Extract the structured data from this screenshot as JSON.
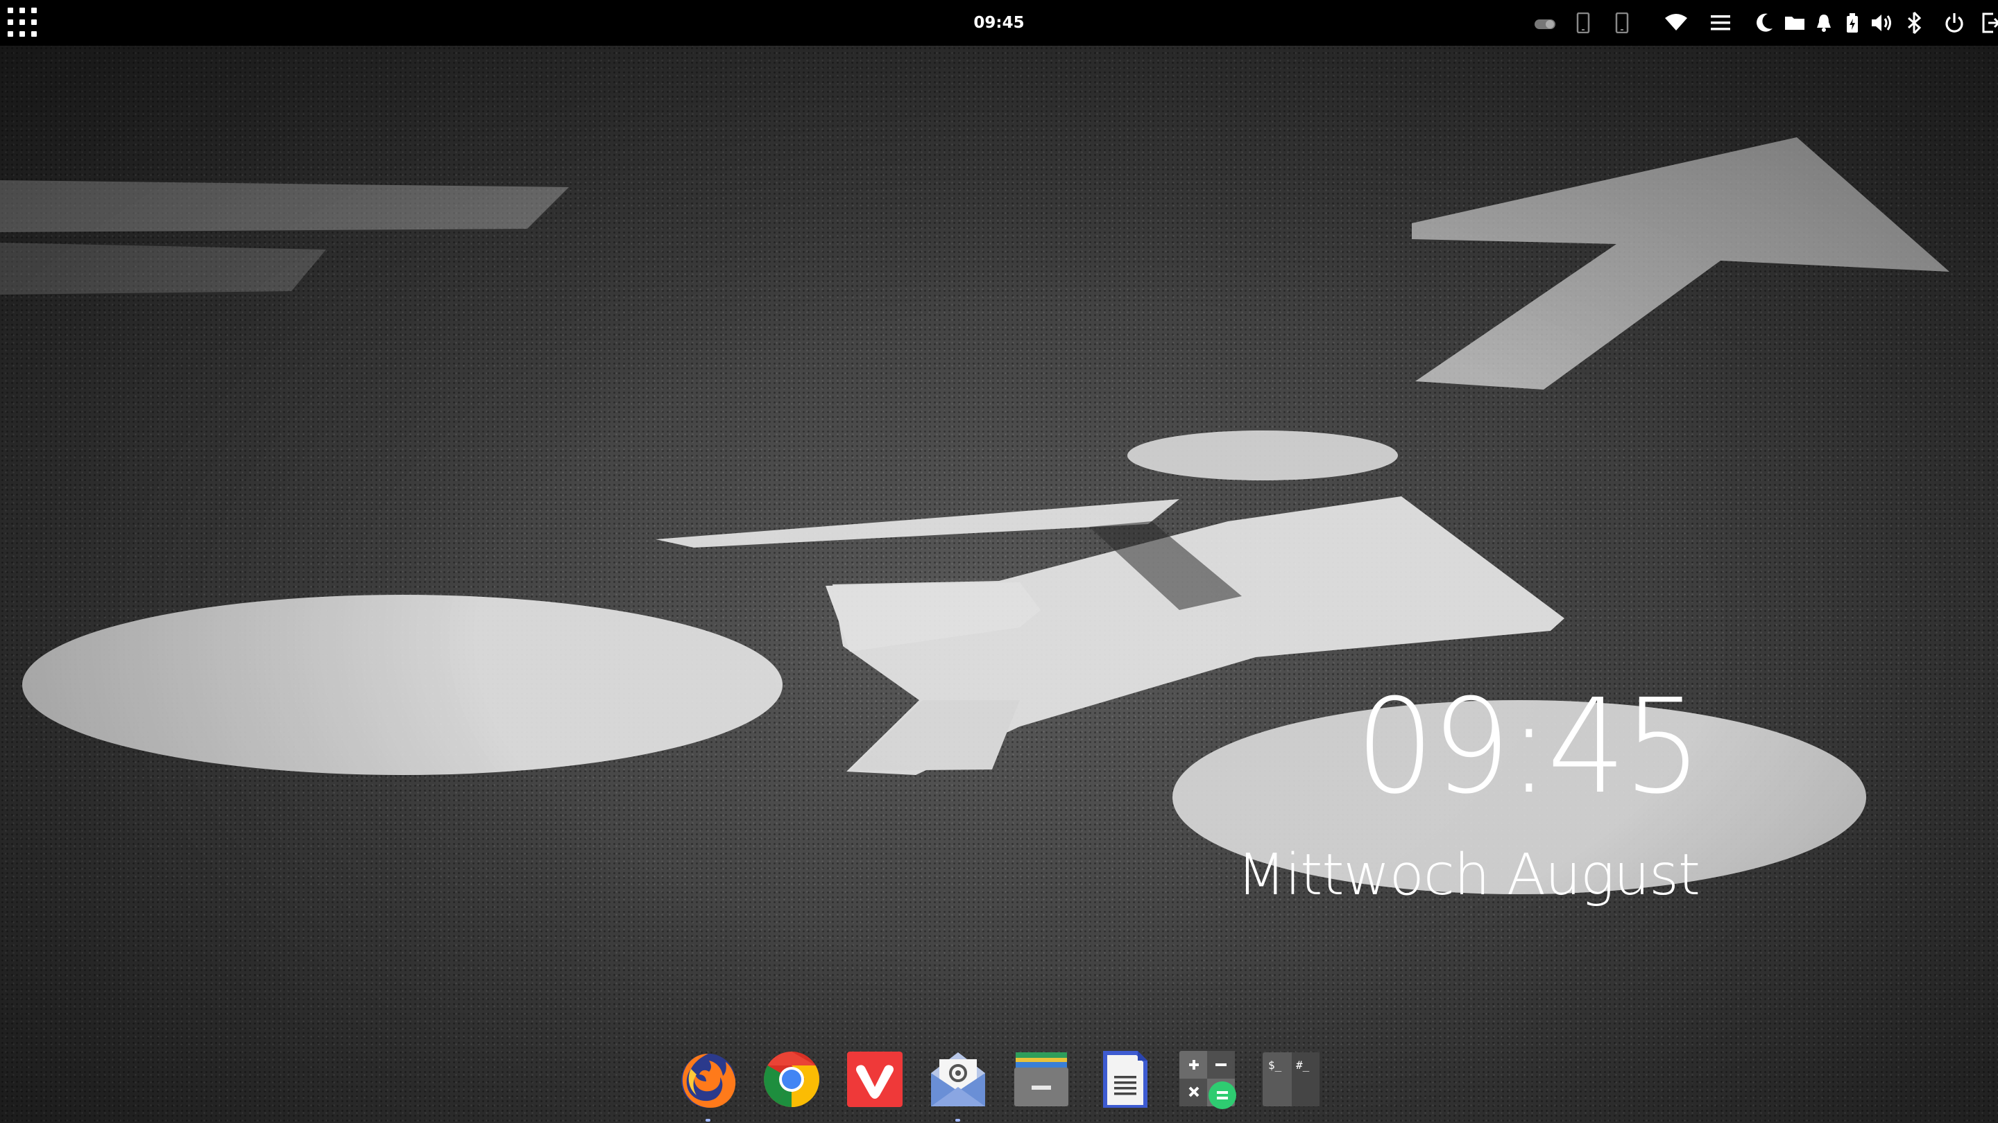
{
  "topbar": {
    "clock": "09:45",
    "apps_button_icon": "app-grid-icon",
    "tray_icons": [
      "toggle-icon",
      "phone-icon",
      "phone-icon",
      "wifi-icon",
      "menu-icon",
      "night-mode-icon",
      "folder-icon",
      "bell-icon",
      "battery-icon",
      "volume-icon",
      "bluetooth-icon",
      "power-icon",
      "logout-icon"
    ]
  },
  "desktop": {
    "wallpaper": "bike-lane-road-marking",
    "widget": {
      "time": "09:45",
      "date": "Mittwoch August"
    }
  },
  "dock": {
    "apps": [
      {
        "name": "Firefox",
        "icon": "firefox-icon",
        "running": true
      },
      {
        "name": "Chrome",
        "icon": "chrome-icon",
        "running": false
      },
      {
        "name": "Vivaldi",
        "icon": "vivaldi-icon",
        "running": false
      },
      {
        "name": "Mail",
        "icon": "mail-icon",
        "running": true
      },
      {
        "name": "Files",
        "icon": "files-icon",
        "running": false
      },
      {
        "name": "Text Editor",
        "icon": "text-editor-icon",
        "running": false
      },
      {
        "name": "Calculator",
        "icon": "calculator-icon",
        "running": false
      },
      {
        "name": "Terminal",
        "icon": "terminal-icon",
        "running": false
      }
    ]
  },
  "colors": {
    "topbar_bg": "#000000",
    "vivaldi_red": "#ef3939",
    "calculator_green": "#2ecc71",
    "mail_blue": "#6a8fd6"
  }
}
